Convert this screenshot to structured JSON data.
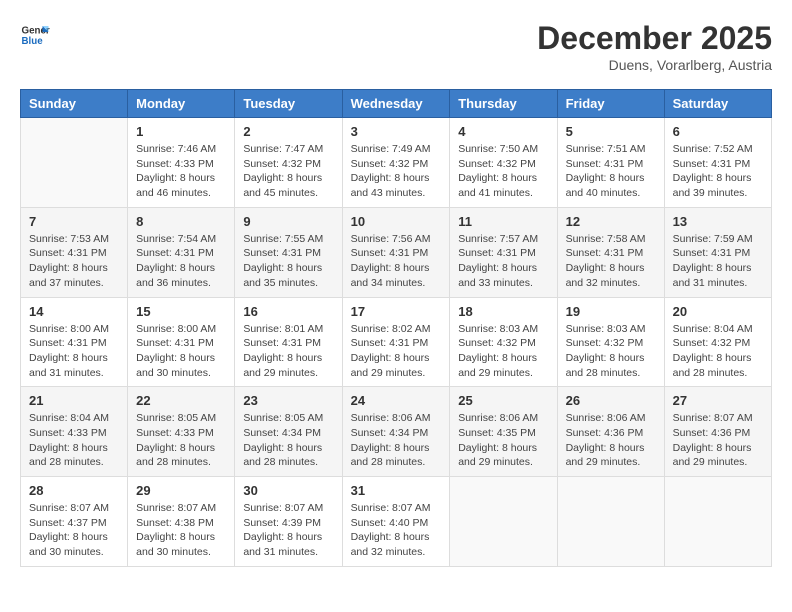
{
  "header": {
    "logo_general": "General",
    "logo_blue": "Blue",
    "month": "December 2025",
    "location": "Duens, Vorarlberg, Austria"
  },
  "weekdays": [
    "Sunday",
    "Monday",
    "Tuesday",
    "Wednesday",
    "Thursday",
    "Friday",
    "Saturday"
  ],
  "weeks": [
    [
      {
        "day": "",
        "sunrise": "",
        "sunset": "",
        "daylight": ""
      },
      {
        "day": "1",
        "sunrise": "Sunrise: 7:46 AM",
        "sunset": "Sunset: 4:33 PM",
        "daylight": "Daylight: 8 hours and 46 minutes."
      },
      {
        "day": "2",
        "sunrise": "Sunrise: 7:47 AM",
        "sunset": "Sunset: 4:32 PM",
        "daylight": "Daylight: 8 hours and 45 minutes."
      },
      {
        "day": "3",
        "sunrise": "Sunrise: 7:49 AM",
        "sunset": "Sunset: 4:32 PM",
        "daylight": "Daylight: 8 hours and 43 minutes."
      },
      {
        "day": "4",
        "sunrise": "Sunrise: 7:50 AM",
        "sunset": "Sunset: 4:32 PM",
        "daylight": "Daylight: 8 hours and 41 minutes."
      },
      {
        "day": "5",
        "sunrise": "Sunrise: 7:51 AM",
        "sunset": "Sunset: 4:31 PM",
        "daylight": "Daylight: 8 hours and 40 minutes."
      },
      {
        "day": "6",
        "sunrise": "Sunrise: 7:52 AM",
        "sunset": "Sunset: 4:31 PM",
        "daylight": "Daylight: 8 hours and 39 minutes."
      }
    ],
    [
      {
        "day": "7",
        "sunrise": "Sunrise: 7:53 AM",
        "sunset": "Sunset: 4:31 PM",
        "daylight": "Daylight: 8 hours and 37 minutes."
      },
      {
        "day": "8",
        "sunrise": "Sunrise: 7:54 AM",
        "sunset": "Sunset: 4:31 PM",
        "daylight": "Daylight: 8 hours and 36 minutes."
      },
      {
        "day": "9",
        "sunrise": "Sunrise: 7:55 AM",
        "sunset": "Sunset: 4:31 PM",
        "daylight": "Daylight: 8 hours and 35 minutes."
      },
      {
        "day": "10",
        "sunrise": "Sunrise: 7:56 AM",
        "sunset": "Sunset: 4:31 PM",
        "daylight": "Daylight: 8 hours and 34 minutes."
      },
      {
        "day": "11",
        "sunrise": "Sunrise: 7:57 AM",
        "sunset": "Sunset: 4:31 PM",
        "daylight": "Daylight: 8 hours and 33 minutes."
      },
      {
        "day": "12",
        "sunrise": "Sunrise: 7:58 AM",
        "sunset": "Sunset: 4:31 PM",
        "daylight": "Daylight: 8 hours and 32 minutes."
      },
      {
        "day": "13",
        "sunrise": "Sunrise: 7:59 AM",
        "sunset": "Sunset: 4:31 PM",
        "daylight": "Daylight: 8 hours and 31 minutes."
      }
    ],
    [
      {
        "day": "14",
        "sunrise": "Sunrise: 8:00 AM",
        "sunset": "Sunset: 4:31 PM",
        "daylight": "Daylight: 8 hours and 31 minutes."
      },
      {
        "day": "15",
        "sunrise": "Sunrise: 8:00 AM",
        "sunset": "Sunset: 4:31 PM",
        "daylight": "Daylight: 8 hours and 30 minutes."
      },
      {
        "day": "16",
        "sunrise": "Sunrise: 8:01 AM",
        "sunset": "Sunset: 4:31 PM",
        "daylight": "Daylight: 8 hours and 29 minutes."
      },
      {
        "day": "17",
        "sunrise": "Sunrise: 8:02 AM",
        "sunset": "Sunset: 4:31 PM",
        "daylight": "Daylight: 8 hours and 29 minutes."
      },
      {
        "day": "18",
        "sunrise": "Sunrise: 8:03 AM",
        "sunset": "Sunset: 4:32 PM",
        "daylight": "Daylight: 8 hours and 29 minutes."
      },
      {
        "day": "19",
        "sunrise": "Sunrise: 8:03 AM",
        "sunset": "Sunset: 4:32 PM",
        "daylight": "Daylight: 8 hours and 28 minutes."
      },
      {
        "day": "20",
        "sunrise": "Sunrise: 8:04 AM",
        "sunset": "Sunset: 4:32 PM",
        "daylight": "Daylight: 8 hours and 28 minutes."
      }
    ],
    [
      {
        "day": "21",
        "sunrise": "Sunrise: 8:04 AM",
        "sunset": "Sunset: 4:33 PM",
        "daylight": "Daylight: 8 hours and 28 minutes."
      },
      {
        "day": "22",
        "sunrise": "Sunrise: 8:05 AM",
        "sunset": "Sunset: 4:33 PM",
        "daylight": "Daylight: 8 hours and 28 minutes."
      },
      {
        "day": "23",
        "sunrise": "Sunrise: 8:05 AM",
        "sunset": "Sunset: 4:34 PM",
        "daylight": "Daylight: 8 hours and 28 minutes."
      },
      {
        "day": "24",
        "sunrise": "Sunrise: 8:06 AM",
        "sunset": "Sunset: 4:34 PM",
        "daylight": "Daylight: 8 hours and 28 minutes."
      },
      {
        "day": "25",
        "sunrise": "Sunrise: 8:06 AM",
        "sunset": "Sunset: 4:35 PM",
        "daylight": "Daylight: 8 hours and 29 minutes."
      },
      {
        "day": "26",
        "sunrise": "Sunrise: 8:06 AM",
        "sunset": "Sunset: 4:36 PM",
        "daylight": "Daylight: 8 hours and 29 minutes."
      },
      {
        "day": "27",
        "sunrise": "Sunrise: 8:07 AM",
        "sunset": "Sunset: 4:36 PM",
        "daylight": "Daylight: 8 hours and 29 minutes."
      }
    ],
    [
      {
        "day": "28",
        "sunrise": "Sunrise: 8:07 AM",
        "sunset": "Sunset: 4:37 PM",
        "daylight": "Daylight: 8 hours and 30 minutes."
      },
      {
        "day": "29",
        "sunrise": "Sunrise: 8:07 AM",
        "sunset": "Sunset: 4:38 PM",
        "daylight": "Daylight: 8 hours and 30 minutes."
      },
      {
        "day": "30",
        "sunrise": "Sunrise: 8:07 AM",
        "sunset": "Sunset: 4:39 PM",
        "daylight": "Daylight: 8 hours and 31 minutes."
      },
      {
        "day": "31",
        "sunrise": "Sunrise: 8:07 AM",
        "sunset": "Sunset: 4:40 PM",
        "daylight": "Daylight: 8 hours and 32 minutes."
      },
      {
        "day": "",
        "sunrise": "",
        "sunset": "",
        "daylight": ""
      },
      {
        "day": "",
        "sunrise": "",
        "sunset": "",
        "daylight": ""
      },
      {
        "day": "",
        "sunrise": "",
        "sunset": "",
        "daylight": ""
      }
    ]
  ]
}
